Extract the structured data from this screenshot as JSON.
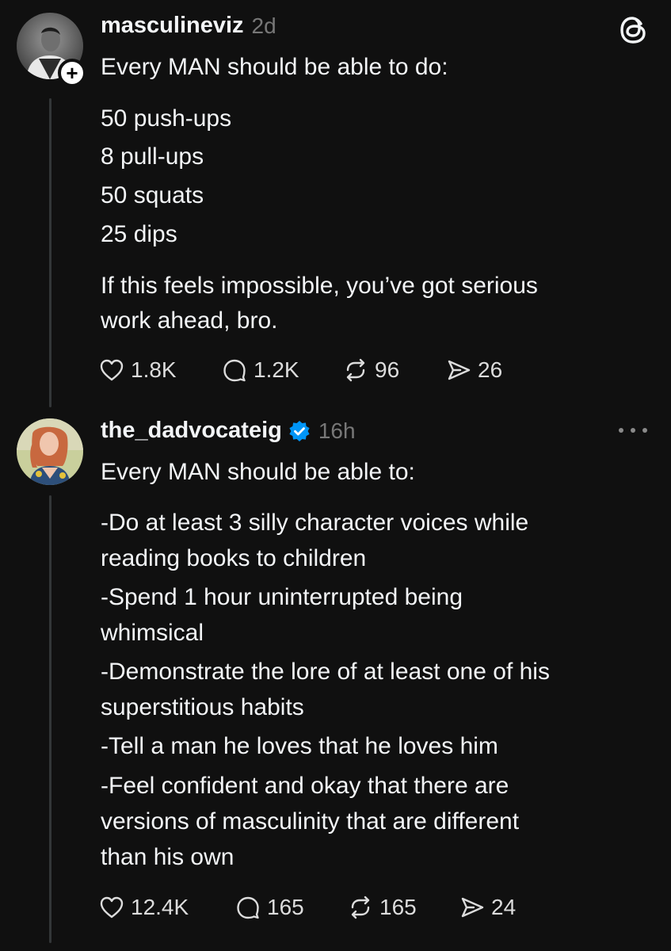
{
  "posts": [
    {
      "username": "masculineviz",
      "time": "2d",
      "follow_glyph": "+",
      "header_icon": "threads-logo-icon",
      "lines": [
        "Every MAN should be able to do:",
        "50 push-ups",
        "8 pull-ups",
        "50 squats",
        "25 dips",
        "If this feels impossible, you’ve got serious",
        "work ahead, bro."
      ],
      "stats": {
        "likes": "1.8K",
        "replies": "1.2K",
        "reposts": "96",
        "shares": "26"
      }
    },
    {
      "username": "the_dadvocateig",
      "verified": true,
      "time": "16h",
      "header_icon": "more-options-icon",
      "lines": [
        "Every MAN should be able to:",
        "-Do at least 3 silly character voices while",
        "reading books to children",
        "-Spend 1 hour uninterrupted being",
        "whimsical",
        "-Demonstrate the lore of at least one of his",
        "superstitious habits",
        "-Tell a man he loves that he loves him",
        "-Feel confident and okay that there are",
        "versions of masculinity that are different",
        "than his own"
      ],
      "stats": {
        "likes": "12.4K",
        "replies": "165",
        "reposts": "165",
        "shares": "24"
      }
    }
  ],
  "colors": {
    "background": "#101010",
    "text": "#f3f5f7",
    "muted": "#777777",
    "verified_blue": "#0095f6",
    "thread_line": "#333638"
  }
}
